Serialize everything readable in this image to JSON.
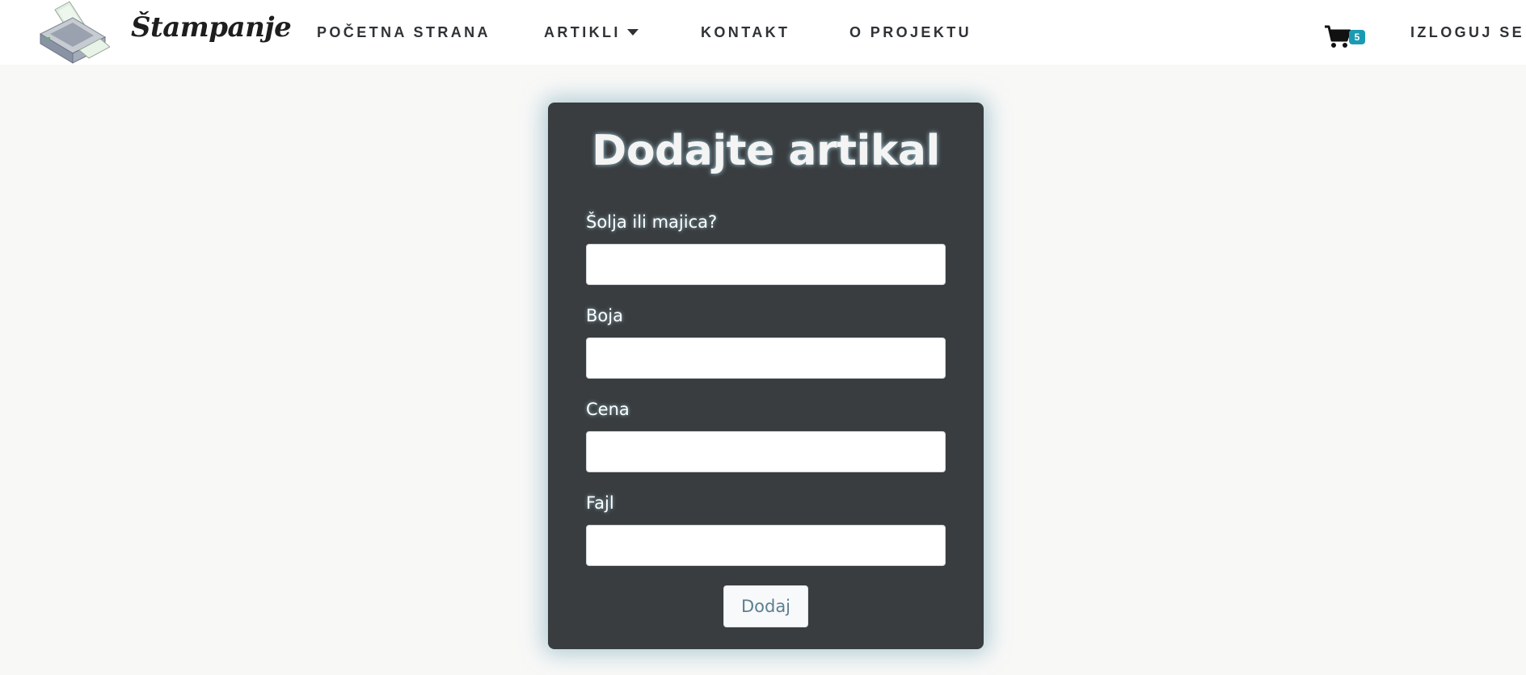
{
  "navbar": {
    "brand": "Štampanje",
    "links": {
      "home": "POČETNA STRANA",
      "articles": "ARTIKLI",
      "contact": "KONTAKT",
      "about": "O PROJEKTU",
      "logout": "IZLOGUJ SE"
    },
    "cart": {
      "icon": "shopping-cart-icon",
      "count": "5",
      "badge_color": "#1a9bb3"
    },
    "logo_icon": "printer-icon"
  },
  "form": {
    "title": "Dodajte artikal",
    "fields": [
      {
        "label": "Šolja ili majica?",
        "value": ""
      },
      {
        "label": "Boja",
        "value": ""
      },
      {
        "label": "Cena",
        "value": ""
      },
      {
        "label": "Fajl",
        "value": ""
      }
    ],
    "submit_label": "Dodaj"
  },
  "colors": {
    "page_bg": "#f8f8f7",
    "card_bg": "#393d40",
    "glow": "#78aab9",
    "button_text": "#5c7f90"
  }
}
